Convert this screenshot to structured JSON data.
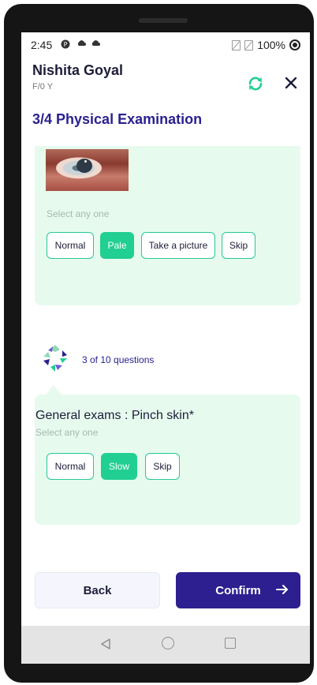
{
  "status_bar": {
    "time": "2:45",
    "battery": "100%"
  },
  "header": {
    "patient_name": "Nishita Goyal",
    "patient_info": "F/0 Y",
    "icons": [
      "refresh-icon",
      "close-icon"
    ]
  },
  "section": {
    "title": "3/4 Physical Examination"
  },
  "previous_question": {
    "image": "eye-photo",
    "hint": "Select any one",
    "options": [
      {
        "label": "Normal",
        "selected": false
      },
      {
        "label": "Pale",
        "selected": true
      },
      {
        "label": "Take a picture",
        "selected": false
      },
      {
        "label": "Skip",
        "selected": false
      }
    ]
  },
  "assistant": {
    "progress_text": "3 of 10 questions"
  },
  "current_question": {
    "title": "General exams : Pinch skin*",
    "hint": "Select any one",
    "options": [
      {
        "label": "Normal",
        "selected": false
      },
      {
        "label": "Slow",
        "selected": true
      },
      {
        "label": "Skip",
        "selected": false
      }
    ]
  },
  "footer": {
    "back_label": "Back",
    "confirm_label": "Confirm"
  },
  "colors": {
    "primary": "#2d1f8f",
    "accent_green": "#22cf93",
    "card_bg": "#e6fbee",
    "title_color": "#2a2190"
  }
}
